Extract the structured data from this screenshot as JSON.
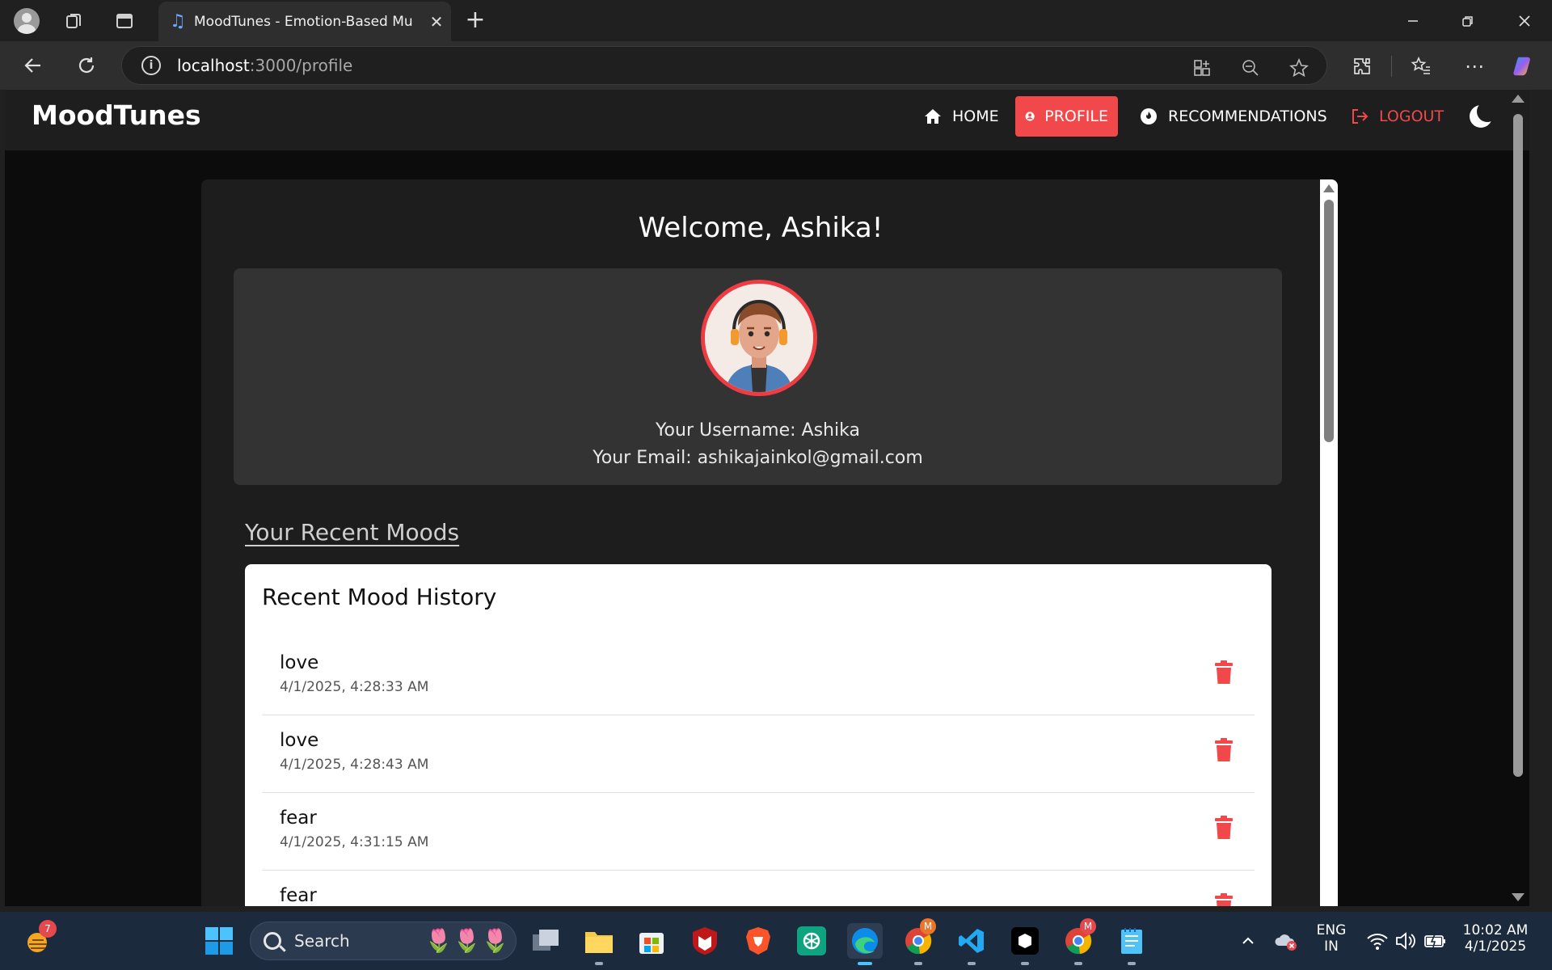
{
  "browser": {
    "tab_title": "MoodTunes - Emotion-Based Mu",
    "url_host": "localhost",
    "url_path": ":3000/profile"
  },
  "app": {
    "brand": "MoodTunes",
    "nav": {
      "home": "HOME",
      "profile": "PROFILE",
      "recommendations": "RECOMMENDATIONS",
      "logout": "LOGOUT"
    },
    "accent_color": "#f0484b"
  },
  "profile": {
    "welcome": "Welcome, Ashika!",
    "username_line": "Your Username: Ashika",
    "email_line": "Your Email: ashikajainkol@gmail.com"
  },
  "moods": {
    "section_heading": "Your Recent Moods",
    "panel_title": "Recent Mood History",
    "items": [
      {
        "mood": "love",
        "time": "4/1/2025, 4:28:33 AM"
      },
      {
        "mood": "love",
        "time": "4/1/2025, 4:28:43 AM"
      },
      {
        "mood": "fear",
        "time": "4/1/2025, 4:31:15 AM"
      },
      {
        "mood": "fear",
        "time": ""
      }
    ]
  },
  "taskbar": {
    "search_placeholder": "Search",
    "weather_badge": "7",
    "lang_top": "ENG",
    "lang_bottom": "IN",
    "time": "10:02 AM",
    "date": "4/1/2025",
    "chrome_badge": "M",
    "chrome2_badge": "M"
  }
}
